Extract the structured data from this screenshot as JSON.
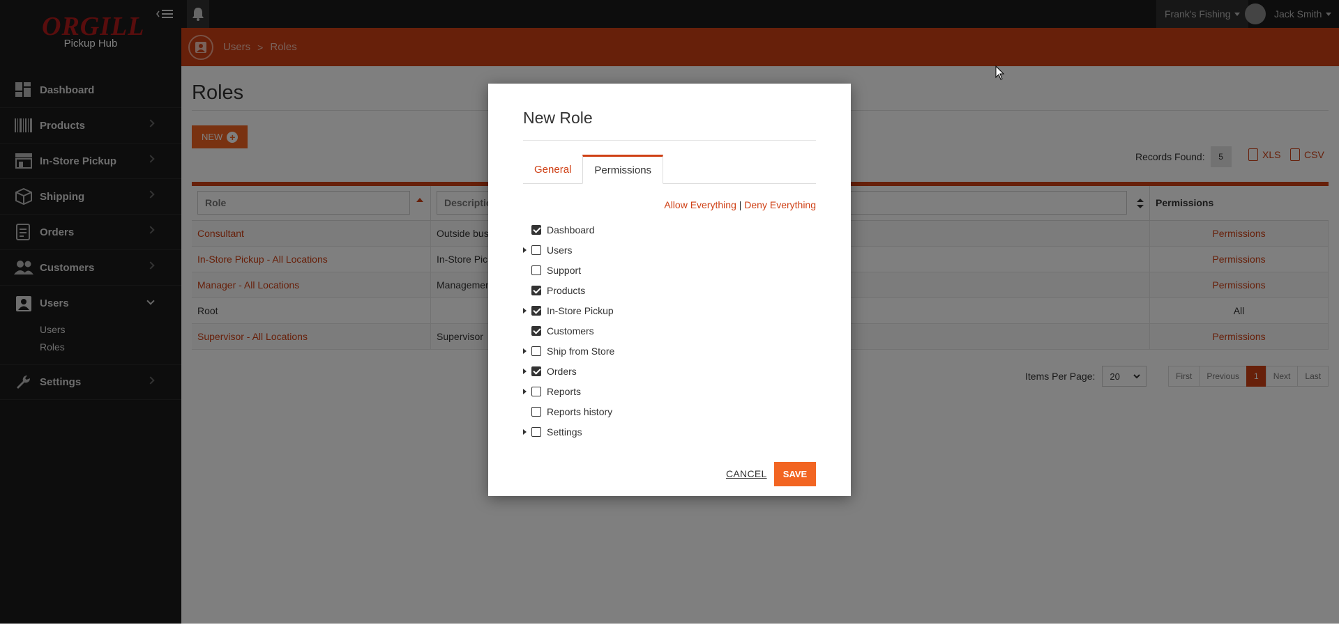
{
  "app": {
    "brand": "ORGILL",
    "brand_sub": "Pickup Hub",
    "store_name": "Frank's Fishing",
    "user_name": "Jack Smith"
  },
  "sidebar": {
    "items": [
      {
        "label": "Dashboard",
        "icon": "dashboard-icon"
      },
      {
        "label": "Products",
        "icon": "barcode-icon"
      },
      {
        "label": "In-Store Pickup",
        "icon": "store-icon"
      },
      {
        "label": "Shipping",
        "icon": "box-icon"
      },
      {
        "label": "Orders",
        "icon": "orders-icon"
      },
      {
        "label": "Customers",
        "icon": "customers-icon"
      },
      {
        "label": "Users",
        "icon": "user-badge-icon"
      },
      {
        "label": "Settings",
        "icon": "wrench-icon"
      }
    ],
    "users_sub": [
      "Users",
      "Roles"
    ]
  },
  "breadcrumb": [
    "Users",
    "Roles"
  ],
  "page": {
    "title": "Roles",
    "new_label": "NEW",
    "records_label": "Records Found:",
    "records_count": "5",
    "export_xls": "XLS",
    "export_csv": "CSV"
  },
  "table": {
    "headers": {
      "role": "Role",
      "description": "Descriptio",
      "permissions": "Permissions"
    },
    "rows": [
      {
        "role": "Consultant",
        "description": "Outside bus",
        "permissions": "Permissions",
        "role_link": true,
        "perm_link": true
      },
      {
        "role": "In-Store Pickup - All Locations",
        "description": "In-Store Pic",
        "permissions": "Permissions",
        "role_link": true,
        "perm_link": true
      },
      {
        "role": "Manager - All Locations",
        "description": "Managemen",
        "permissions": "Permissions",
        "role_link": true,
        "perm_link": true
      },
      {
        "role": "Root",
        "description": "",
        "permissions": "All",
        "role_link": false,
        "perm_link": false
      },
      {
        "role": "Supervisor - All Locations",
        "description": "Supervisor",
        "permissions": "Permissions",
        "role_link": true,
        "perm_link": true
      }
    ]
  },
  "pagination": {
    "items_per_page_label": "Items Per Page:",
    "items_per_page": "20",
    "first": "First",
    "previous": "Previous",
    "current": "1",
    "next": "Next",
    "last": "Last"
  },
  "modal": {
    "title": "New Role",
    "tabs": [
      "General",
      "Permissions"
    ],
    "active_tab": "Permissions",
    "allow_all": "Allow Everything",
    "separator": "|",
    "deny_all": "Deny Everything",
    "permissions": [
      {
        "label": "Dashboard",
        "checked": true,
        "expandable": false
      },
      {
        "label": "Users",
        "checked": false,
        "expandable": true
      },
      {
        "label": "Support",
        "checked": false,
        "expandable": false
      },
      {
        "label": "Products",
        "checked": true,
        "expandable": false
      },
      {
        "label": "In-Store Pickup",
        "checked": true,
        "expandable": true
      },
      {
        "label": "Customers",
        "checked": true,
        "expandable": false
      },
      {
        "label": "Ship from Store",
        "checked": false,
        "expandable": true
      },
      {
        "label": "Orders",
        "checked": true,
        "expandable": true
      },
      {
        "label": "Reports",
        "checked": false,
        "expandable": true
      },
      {
        "label": "Reports history",
        "checked": false,
        "expandable": false
      },
      {
        "label": "Settings",
        "checked": false,
        "expandable": true
      }
    ],
    "cancel_label": "CANCEL",
    "save_label": "SAVE"
  },
  "colors": {
    "accent": "#cf4015",
    "button": "#f26522",
    "sidebar": "#1a1a1a"
  }
}
